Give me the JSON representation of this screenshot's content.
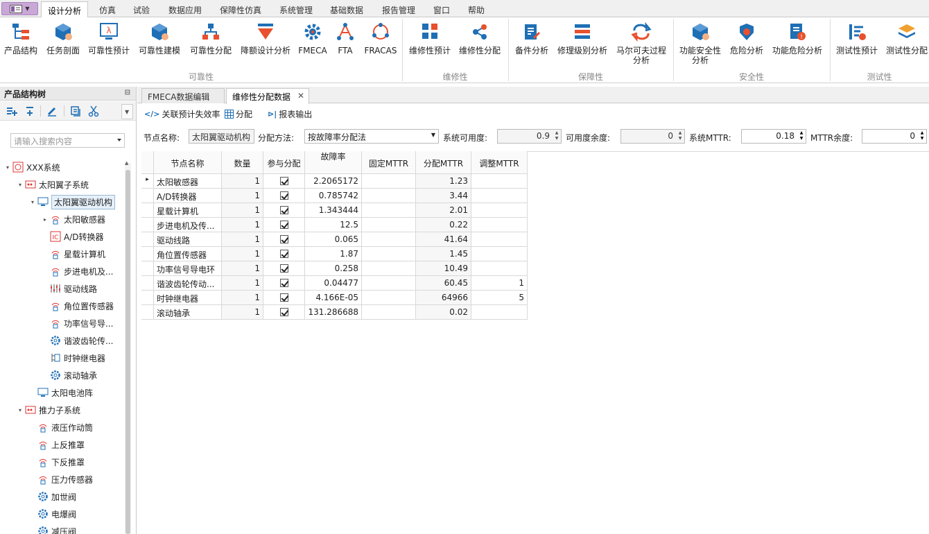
{
  "menubar": {
    "app_button_icon": "app-menu-icon",
    "tabs": [
      "设计分析",
      "仿真",
      "试验",
      "数据应用",
      "保障性仿真",
      "系统管理",
      "基础数据",
      "报告管理",
      "窗口",
      "帮助"
    ],
    "active_tab": "设计分析"
  },
  "ribbon": {
    "groups": [
      {
        "label": "可靠性",
        "buttons": [
          "产品结构",
          "任务剖面",
          "可靠性预计",
          "可靠性建模",
          "可靠性分配",
          "降额设计分析",
          "FMECA",
          "FTA",
          "FRACAS"
        ]
      },
      {
        "label": "维修性",
        "buttons": [
          "维修性预计",
          "维修性分配"
        ]
      },
      {
        "label": "保障性",
        "buttons": [
          "备件分析",
          "修理级别分析",
          "马尔可夫过程",
          "分析"
        ]
      },
      {
        "label": "安全性",
        "buttons": [
          "功能安全性",
          "分析",
          "危险分析",
          "功能危险分析"
        ]
      },
      {
        "label": "测试性",
        "buttons": [
          "测试性预计",
          "测试性分配"
        ]
      }
    ],
    "accent_color": "#1f6fb5",
    "warn_color": "#e8502e"
  },
  "left_panel": {
    "title": "产品结构树",
    "pin_icon": "pin-icon",
    "search_placeholder": "请输入搜索内容",
    "tree": [
      {
        "label": "XXX系统",
        "level": 0,
        "icon": "system-icon",
        "expanded": true
      },
      {
        "label": "太阳翼子系统",
        "level": 1,
        "icon": "subsystem-icon",
        "expanded": true
      },
      {
        "label": "太阳翼驱动机构",
        "level": 2,
        "icon": "monitor-icon",
        "expanded": true,
        "selected": true
      },
      {
        "label": "太阳敏感器",
        "level": 3,
        "icon": "sensor-icon",
        "collapsed": true
      },
      {
        "label": "A/D转换器",
        "level": 3,
        "icon": "ic-chip-icon"
      },
      {
        "label": "星载计算机",
        "level": 3,
        "icon": "sensor-icon"
      },
      {
        "label": "步进电机及...",
        "level": 3,
        "icon": "sensor-icon"
      },
      {
        "label": "驱动线路",
        "level": 3,
        "icon": "circuit-icon"
      },
      {
        "label": "角位置传感器",
        "level": 3,
        "icon": "sensor-icon"
      },
      {
        "label": "功率信号导...",
        "level": 3,
        "icon": "sensor-icon"
      },
      {
        "label": "谐波齿轮传...",
        "level": 3,
        "icon": "gear-icon"
      },
      {
        "label": "时钟继电器",
        "level": 3,
        "icon": "relay-icon"
      },
      {
        "label": "滚动轴承",
        "level": 3,
        "icon": "gear-icon"
      },
      {
        "label": "太阳电池阵",
        "level": 2,
        "icon": "monitor-icon"
      },
      {
        "label": "推力子系统",
        "level": 1,
        "icon": "subsystem-icon",
        "expanded": true
      },
      {
        "label": "液压作动筒",
        "level": 2,
        "icon": "sensor-icon"
      },
      {
        "label": "上反推罩",
        "level": 2,
        "icon": "sensor-icon"
      },
      {
        "label": "下反推罩",
        "level": 2,
        "icon": "sensor-icon"
      },
      {
        "label": "压力传感器",
        "level": 2,
        "icon": "sensor-icon"
      },
      {
        "label": "加世阀",
        "level": 2,
        "icon": "gear-icon"
      },
      {
        "label": "电爆阀",
        "level": 2,
        "icon": "gear-icon"
      },
      {
        "label": "减压阀",
        "level": 2,
        "icon": "gear-icon"
      }
    ]
  },
  "doc_tabs": [
    {
      "label": "FMECA数据编辑",
      "active": false
    },
    {
      "label": "维修性分配数据",
      "active": true,
      "close_icon": "close-icon"
    }
  ],
  "toolbar": {
    "link_label": "关联预计失效率",
    "assign_label": "分配",
    "export_label": "报表输出"
  },
  "form": {
    "node_label": "节点名称:",
    "node_value": "太阳翼驱动机构",
    "method_label": "分配方法:",
    "method_value": "按故障率分配法",
    "avail_label": "系统可用度:",
    "avail_value": "0.9",
    "avail_margin_label": "可用度余度:",
    "avail_margin_value": "0",
    "mttr_label": "系统MTTR:",
    "mttr_value": "0.18",
    "mttr_margin_label": "MTTR余度:",
    "mttr_margin_value": "0"
  },
  "grid": {
    "columns": [
      "节点名称",
      "数量",
      "参与分配",
      "故障率",
      "固定MTTR",
      "分配MTTR",
      "调整MTTR"
    ],
    "rows": [
      {
        "name": "太阳敏感器",
        "qty": "1",
        "participate": true,
        "failure_rate": "2.2065172",
        "fixed_mttr": "",
        "assigned_mttr": "1.23",
        "adjusted_mttr": "",
        "current": true
      },
      {
        "name": "A/D转换器",
        "qty": "1",
        "participate": true,
        "failure_rate": "0.785742",
        "fixed_mttr": "",
        "assigned_mttr": "3.44",
        "adjusted_mttr": ""
      },
      {
        "name": "星载计算机",
        "qty": "1",
        "participate": true,
        "failure_rate": "1.343444",
        "fixed_mttr": "",
        "assigned_mttr": "2.01",
        "adjusted_mttr": ""
      },
      {
        "name": "步进电机及传...",
        "qty": "1",
        "participate": true,
        "failure_rate": "12.5",
        "fixed_mttr": "",
        "assigned_mttr": "0.22",
        "adjusted_mttr": ""
      },
      {
        "name": "驱动线路",
        "qty": "1",
        "participate": true,
        "failure_rate": "0.065",
        "fixed_mttr": "",
        "assigned_mttr": "41.64",
        "adjusted_mttr": ""
      },
      {
        "name": "角位置传感器",
        "qty": "1",
        "participate": true,
        "failure_rate": "1.87",
        "fixed_mttr": "",
        "assigned_mttr": "1.45",
        "adjusted_mttr": ""
      },
      {
        "name": "功率信号导电环",
        "qty": "1",
        "participate": true,
        "failure_rate": "0.258",
        "fixed_mttr": "",
        "assigned_mttr": "10.49",
        "adjusted_mttr": ""
      },
      {
        "name": "谐波齿轮传动...",
        "qty": "1",
        "participate": true,
        "failure_rate": "0.04477",
        "fixed_mttr": "",
        "assigned_mttr": "60.45",
        "adjusted_mttr": "1"
      },
      {
        "name": "时钟继电器",
        "qty": "1",
        "participate": true,
        "failure_rate": "4.166E-05",
        "fixed_mttr": "",
        "assigned_mttr": "64966",
        "adjusted_mttr": "5"
      },
      {
        "name": "滚动轴承",
        "qty": "1",
        "participate": true,
        "failure_rate": "131.286688",
        "fixed_mttr": "",
        "assigned_mttr": "0.02",
        "adjusted_mttr": ""
      }
    ]
  }
}
